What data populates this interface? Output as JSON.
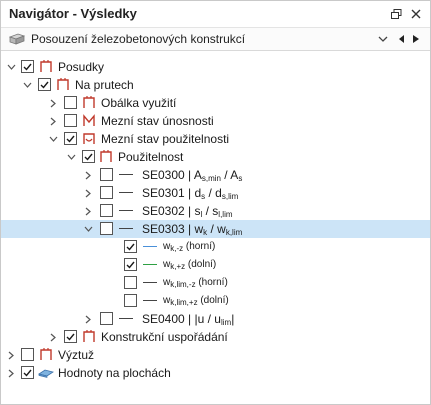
{
  "window": {
    "title": "Navigátor - Výsledky"
  },
  "toolbar": {
    "dropdown_value": "Posouzení železobetonových konstrukcí"
  },
  "colors": {
    "selection": "#cce4f7",
    "member_icon": "#c0392b",
    "green_line": "#2ea043",
    "blue_line": "#4a90d9"
  },
  "tree": {
    "posudky": "Posudky",
    "na_prutech": "Na prutech",
    "obalka": "Obálka využití",
    "mezni_unosnosti": "Mezní stav únosnosti",
    "mezni_pouzitelnosti": "Mezní stav použitelnosti",
    "pouzitelnost": "Použitelnost",
    "se0300": {
      "code": "SE0300 | A",
      "s1": "s,min",
      "m": " / A",
      "s2": "s"
    },
    "se0301": {
      "code": "SE0301 | d",
      "s1": "s",
      "m": " / d",
      "s2": "s,lim"
    },
    "se0302": {
      "code": "SE0302 | s",
      "s1": "l",
      "m": " / s",
      "s2": "l,lim"
    },
    "se0303": {
      "code": "SE0303 | w",
      "s1": "k",
      "m": " / w",
      "s2": "k,lim"
    },
    "wk_minus": {
      "base": "w",
      "sub": "k,-z",
      "suffix": " (horní)"
    },
    "wk_plus": {
      "base": "w",
      "sub": "k,+z",
      "suffix": " (dolní)"
    },
    "wklim_minus": {
      "base": "w",
      "sub": "k,lim,-z",
      "suffix": " (horní)"
    },
    "wklim_plus": {
      "base": "w",
      "sub": "k,lim,+z",
      "suffix": " (dolní)"
    },
    "se0400": {
      "code": "SE0400 | |u / u",
      "s1": "lim",
      "m": "|"
    },
    "konstrukcni": "Konstrukční uspořádání",
    "vyztuz": "Výztuž",
    "hodnoty": "Hodnoty na plochách"
  }
}
